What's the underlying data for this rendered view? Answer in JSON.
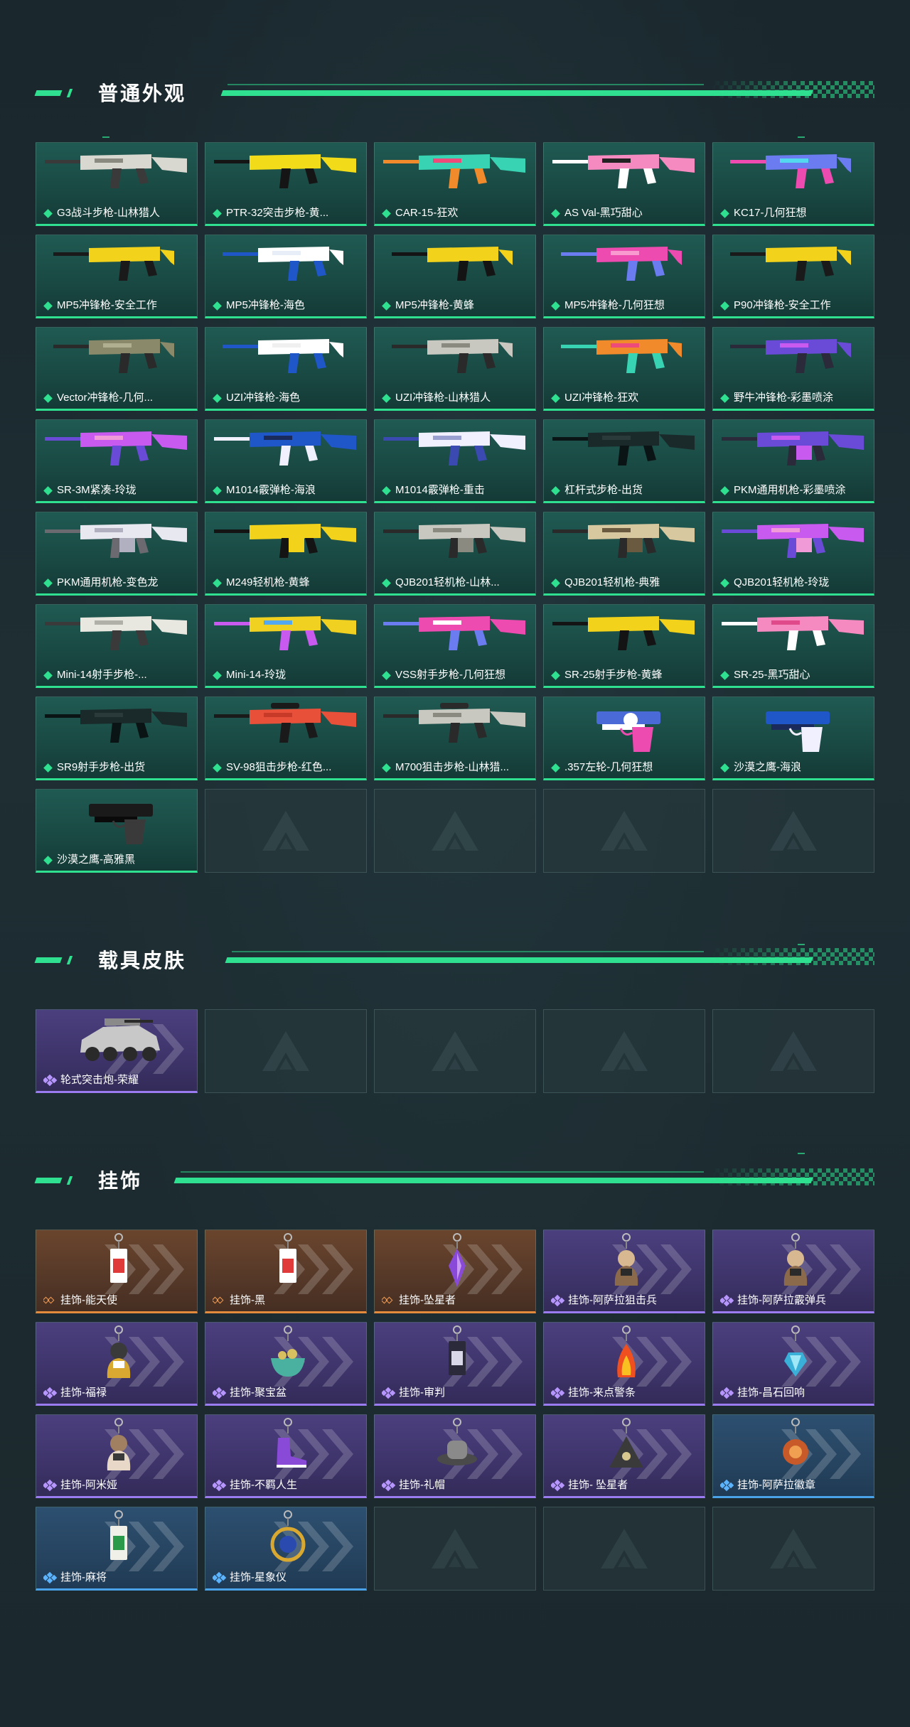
{
  "colors": {
    "accent": "#2ee08f",
    "card_green": "#1f5a52",
    "card_purple": "#4b3f7e",
    "card_orange": "#6a452d",
    "card_blue": "#2d4f70"
  },
  "sections": [
    {
      "title": "普通外观",
      "items": [
        {
          "label": "G3战斗步枪-山林猎人",
          "rarity": "green",
          "icon": "rifle-icon",
          "art": [
            "#d8d8d0",
            "#3a3a3a",
            "#8a8a80"
          ]
        },
        {
          "label": "PTR-32突击步枪-黄...",
          "rarity": "green",
          "icon": "rifle-icon",
          "art": [
            "#f2dc1a",
            "#151515",
            "#f2dc1a"
          ]
        },
        {
          "label": "CAR-15-狂欢",
          "rarity": "green",
          "icon": "rifle-icon",
          "art": [
            "#38d3b3",
            "#f08a2a",
            "#ee4b7b"
          ]
        },
        {
          "label": "AS Val-黑巧甜心",
          "rarity": "green",
          "icon": "rifle-icon",
          "art": [
            "#f58ac0",
            "#ffffff",
            "#222222"
          ]
        },
        {
          "label": "KC17-几何狂想",
          "rarity": "green",
          "icon": "smg-icon",
          "art": [
            "#6a7cf0",
            "#ee4bb0",
            "#54d8f0"
          ]
        },
        {
          "label": "MP5冲锋枪-安全工作",
          "rarity": "green",
          "icon": "smg-icon",
          "art": [
            "#f2d21a",
            "#1a1a1a",
            "#f2d21a"
          ]
        },
        {
          "label": "MP5冲锋枪-海色",
          "rarity": "green",
          "icon": "smg-icon",
          "art": [
            "#ffffff",
            "#1f56c8",
            "#e8eef8"
          ]
        },
        {
          "label": "MP5冲锋枪-黄蜂",
          "rarity": "green",
          "icon": "smg-icon",
          "art": [
            "#f2d21a",
            "#141414",
            "#f2d21a"
          ]
        },
        {
          "label": "MP5冲锋枪-几何狂想",
          "rarity": "green",
          "icon": "smg-icon",
          "art": [
            "#ee4bb0",
            "#6a7cf0",
            "#f89ad0"
          ]
        },
        {
          "label": "P90冲锋枪-安全工作",
          "rarity": "green",
          "icon": "smg-icon",
          "art": [
            "#f2d21a",
            "#1a1a1a",
            "#f2d21a"
          ]
        },
        {
          "label": "Vector冲锋枪-几何...",
          "rarity": "green",
          "icon": "smg-icon",
          "art": [
            "#8a8a6a",
            "#2a2a2a",
            "#b0b090"
          ]
        },
        {
          "label": "UZI冲锋枪-海色",
          "rarity": "green",
          "icon": "smg-icon",
          "art": [
            "#ffffff",
            "#1f56c8",
            "#f0f0f0"
          ]
        },
        {
          "label": "UZI冲锋枪-山林猎人",
          "rarity": "green",
          "icon": "smg-icon",
          "art": [
            "#c8c8c0",
            "#2a2a2a",
            "#8a8a80"
          ]
        },
        {
          "label": "UZI冲锋枪-狂欢",
          "rarity": "green",
          "icon": "smg-icon",
          "art": [
            "#f08a2a",
            "#38d3b3",
            "#ee4b7b"
          ]
        },
        {
          "label": "野牛冲锋枪-彩墨喷涂",
          "rarity": "green",
          "icon": "smg-icon",
          "art": [
            "#6a4bd8",
            "#2a2a3a",
            "#c85af0"
          ]
        },
        {
          "label": "SR-3M紧凑-玲珑",
          "rarity": "green",
          "icon": "rifle-icon",
          "art": [
            "#c85af0",
            "#6a4bd8",
            "#f09ad8"
          ]
        },
        {
          "label": "M1014霰弹枪-海浪",
          "rarity": "green",
          "icon": "shotgun-icon",
          "art": [
            "#1f56c8",
            "#f0f0ff",
            "#1a2a5a"
          ]
        },
        {
          "label": "M1014霰弹枪-重击",
          "rarity": "green",
          "icon": "shotgun-icon",
          "art": [
            "#f0f0ff",
            "#3a4ab0",
            "#9aa0d0"
          ]
        },
        {
          "label": "杠杆式步枪-出货",
          "rarity": "green",
          "icon": "rifle-icon",
          "art": [
            "#1a2a2a",
            "#0a1414",
            "#2a3a3a"
          ]
        },
        {
          "label": "PKM通用机枪-彩墨喷涂",
          "rarity": "green",
          "icon": "mg-icon",
          "art": [
            "#6a4bd8",
            "#2a2a3a",
            "#c85af0"
          ]
        },
        {
          "label": "PKM通用机枪-变色龙",
          "rarity": "green",
          "icon": "mg-icon",
          "art": [
            "#e8e8f0",
            "#6a6a70",
            "#b0b0c0"
          ]
        },
        {
          "label": "M249轻机枪-黄蜂",
          "rarity": "green",
          "icon": "mg-icon",
          "art": [
            "#f2d21a",
            "#141414",
            "#f2d21a"
          ]
        },
        {
          "label": "QJB201轻机枪-山林...",
          "rarity": "green",
          "icon": "mg-icon",
          "art": [
            "#c8c8c0",
            "#2a2a2a",
            "#8a8a80"
          ]
        },
        {
          "label": "QJB201轻机枪-典雅",
          "rarity": "green",
          "icon": "mg-icon",
          "art": [
            "#d8c8a0",
            "#2a2a2a",
            "#6a5a40"
          ]
        },
        {
          "label": "QJB201轻机枪-玲珑",
          "rarity": "green",
          "icon": "mg-icon",
          "art": [
            "#c85af0",
            "#6a4bd8",
            "#f09ad8"
          ]
        },
        {
          "label": "Mini-14射手步枪-...",
          "rarity": "green",
          "icon": "rifle-icon",
          "art": [
            "#e8e8e0",
            "#3a3a3a",
            "#b0b0a8"
          ]
        },
        {
          "label": "Mini-14-玲珑",
          "rarity": "green",
          "icon": "rifle-icon",
          "art": [
            "#f0d020",
            "#c85af0",
            "#54a8f0"
          ]
        },
        {
          "label": "VSS射手步枪-几何狂想",
          "rarity": "green",
          "icon": "rifle-icon",
          "art": [
            "#ee4bb0",
            "#6a7cf0",
            "#ffffff"
          ]
        },
        {
          "label": "SR-25射手步枪-黄蜂",
          "rarity": "green",
          "icon": "rifle-icon",
          "art": [
            "#f2d21a",
            "#141414",
            "#f2d21a"
          ]
        },
        {
          "label": "SR-25-黑巧甜心",
          "rarity": "green",
          "icon": "rifle-icon",
          "art": [
            "#f58ac0",
            "#ffffff",
            "#e04a8a"
          ]
        },
        {
          "label": "SR9射手步枪-出货",
          "rarity": "green",
          "icon": "rifle-icon",
          "art": [
            "#1a2a2a",
            "#0a1414",
            "#2a3a3a"
          ]
        },
        {
          "label": "SV-98狙击步枪-红色...",
          "rarity": "green",
          "icon": "sniper-icon",
          "art": [
            "#e8503a",
            "#1a1a1a",
            "#c83a28"
          ]
        },
        {
          "label": "M700狙击步枪-山林猎...",
          "rarity": "green",
          "icon": "sniper-icon",
          "art": [
            "#c8c8c0",
            "#2a2a2a",
            "#8a8a80"
          ]
        },
        {
          "label": ".357左轮-几何狂想",
          "rarity": "green",
          "icon": "revolver-icon",
          "art": [
            "#4a6ad8",
            "#ee4bb0",
            "#ffffff"
          ]
        },
        {
          "label": "沙漠之鹰-海浪",
          "rarity": "green",
          "icon": "pistol-icon",
          "art": [
            "#1f56c8",
            "#f0f0ff",
            "#1a2a5a"
          ]
        },
        {
          "label": "沙漠之鹰-高雅黑",
          "rarity": "green",
          "icon": "pistol-icon",
          "art": [
            "#1a1a1a",
            "#3a3a3a",
            "#0a0a0a"
          ]
        }
      ],
      "empty_slots": 4
    },
    {
      "title": "载具皮肤",
      "items": [
        {
          "label": "轮式突击炮-荣耀",
          "rarity": "purple",
          "icon": "vehicle-icon",
          "art": [
            "#c8c8c8",
            "#2a2a2a",
            "#8a8a8a"
          ]
        }
      ],
      "empty_slots": 4
    },
    {
      "title": "挂饰",
      "items": [
        {
          "label": "挂饰-能天使",
          "rarity": "orange",
          "icon": "charm-tag-icon",
          "art": [
            "#ffffff",
            "#e03a3a",
            "#8a8a8a"
          ]
        },
        {
          "label": "挂饰-黑",
          "rarity": "orange",
          "icon": "charm-tag-icon",
          "art": [
            "#ffffff",
            "#e03a3a",
            "#8a8a8a"
          ]
        },
        {
          "label": "挂饰-坠星者",
          "rarity": "orange",
          "icon": "charm-crystal-icon",
          "art": [
            "#8a4ad8",
            "#c89af0",
            "#5a2aa0"
          ]
        },
        {
          "label": "挂饰-阿萨拉狙击兵",
          "rarity": "purple",
          "icon": "charm-figure-icon",
          "art": [
            "#8a6a4a",
            "#2a2a2a",
            "#d8b890"
          ]
        },
        {
          "label": "挂饰-阿萨拉霰弹兵",
          "rarity": "purple",
          "icon": "charm-figure-icon",
          "art": [
            "#8a6a4a",
            "#2a2a2a",
            "#d8b890"
          ]
        },
        {
          "label": "挂饰-福禄",
          "rarity": "purple",
          "icon": "charm-figure-icon",
          "art": [
            "#d8a830",
            "#ffffff",
            "#3a3a3a"
          ]
        },
        {
          "label": "挂饰-聚宝盆",
          "rarity": "purple",
          "icon": "charm-bowl-icon",
          "art": [
            "#4ab0a0",
            "#d8c060",
            "#ffffff"
          ]
        },
        {
          "label": "挂饰-审判",
          "rarity": "purple",
          "icon": "charm-card-icon",
          "art": [
            "#2a2a3a",
            "#d8d8e8",
            "#6a6a8a"
          ]
        },
        {
          "label": "挂饰-来点警条",
          "rarity": "purple",
          "icon": "charm-fire-icon",
          "art": [
            "#f05020",
            "#f8c020",
            "#d82a10"
          ]
        },
        {
          "label": "挂饰-昌石回响",
          "rarity": "purple",
          "icon": "charm-gem-icon",
          "art": [
            "#3ab0d8",
            "#a0e8f8",
            "#1a6a90"
          ]
        },
        {
          "label": "挂饰-阿米娅",
          "rarity": "purple",
          "icon": "charm-figure-icon",
          "art": [
            "#e8d8c8",
            "#3a3a3a",
            "#a08060"
          ]
        },
        {
          "label": "挂饰-不羁人生",
          "rarity": "purple",
          "icon": "charm-shoe-icon",
          "art": [
            "#8a4ad8",
            "#c89af0",
            "#ffffff"
          ]
        },
        {
          "label": "挂饰-礼帽",
          "rarity": "purple",
          "icon": "charm-hat-icon",
          "art": [
            "#8a8a8a",
            "#4a4a4a",
            "#c8c8c8"
          ]
        },
        {
          "label": "挂饰- 坠星者",
          "rarity": "purple",
          "icon": "charm-triangle-icon",
          "art": [
            "#3a3a3a",
            "#d8c890",
            "#6a6a6a"
          ]
        },
        {
          "label": "挂饰-阿萨拉徽章",
          "rarity": "blue",
          "icon": "charm-badge-icon",
          "art": [
            "#c85a2a",
            "#f0a050",
            "#6a2a10"
          ]
        },
        {
          "label": "挂饰-麻将",
          "rarity": "blue",
          "icon": "charm-tile-icon",
          "art": [
            "#f0f0e8",
            "#2a9a4a",
            "#d82a2a"
          ]
        },
        {
          "label": "挂饰-星象仪",
          "rarity": "blue",
          "icon": "charm-astrolabe-icon",
          "art": [
            "#d8a830",
            "#2a4ab0",
            "#8a6a20"
          ]
        }
      ],
      "empty_slots": 3
    }
  ]
}
